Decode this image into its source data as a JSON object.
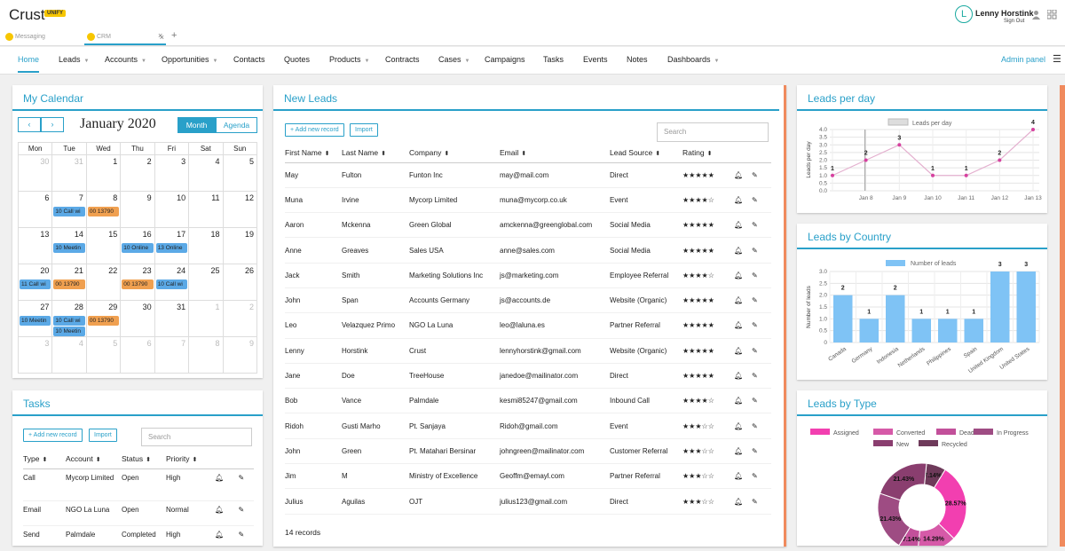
{
  "app": {
    "brand": "Crust",
    "badge": "UNIFY",
    "user_name": "Lenny Horstink",
    "sign_out": "Sign Out",
    "avatar": "L"
  },
  "browser_tabs": [
    {
      "label": "Messaging"
    },
    {
      "label": "CRM"
    }
  ],
  "nav": {
    "items": [
      {
        "label": "Home",
        "caret": false
      },
      {
        "label": "Leads",
        "caret": true
      },
      {
        "label": "Accounts",
        "caret": true
      },
      {
        "label": "Opportunities",
        "caret": true
      },
      {
        "label": "Contacts",
        "caret": false
      },
      {
        "label": "Quotes",
        "caret": false
      },
      {
        "label": "Products",
        "caret": true
      },
      {
        "label": "Contracts",
        "caret": false
      },
      {
        "label": "Cases",
        "caret": true
      },
      {
        "label": "Campaigns",
        "caret": false
      },
      {
        "label": "Tasks",
        "caret": false
      },
      {
        "label": "Events",
        "caret": false
      },
      {
        "label": "Notes",
        "caret": false
      },
      {
        "label": "Dashboards",
        "caret": true
      }
    ],
    "admin": "Admin panel"
  },
  "calendar": {
    "title": "My Calendar",
    "month": "January 2020",
    "view_month": "Month",
    "view_agenda": "Agenda",
    "days": [
      "Mon",
      "Tue",
      "Wed",
      "Thu",
      "Fri",
      "Sat",
      "Sun"
    ],
    "weeks": [
      [
        {
          "d": "30",
          "off": true
        },
        {
          "d": "31",
          "off": true
        },
        {
          "d": "1"
        },
        {
          "d": "2"
        },
        {
          "d": "3"
        },
        {
          "d": "4"
        },
        {
          "d": "5"
        }
      ],
      [
        {
          "d": "6"
        },
        {
          "d": "7",
          "ev": [
            {
              "t": "10 Call wi",
              "c": "b"
            }
          ]
        },
        {
          "d": "8",
          "ev": [
            {
              "t": "00 13790",
              "c": "o"
            }
          ]
        },
        {
          "d": "9"
        },
        {
          "d": "10"
        },
        {
          "d": "11"
        },
        {
          "d": "12"
        }
      ],
      [
        {
          "d": "13"
        },
        {
          "d": "14",
          "ev": [
            {
              "t": "10 Meetin",
              "c": "b"
            }
          ]
        },
        {
          "d": "15"
        },
        {
          "d": "16",
          "ev": [
            {
              "t": "10 Online",
              "c": "b"
            }
          ]
        },
        {
          "d": "17",
          "ev": [
            {
              "t": "13 Online",
              "c": "b"
            }
          ]
        },
        {
          "d": "18"
        },
        {
          "d": "19"
        }
      ],
      [
        {
          "d": "20",
          "ev": [
            {
              "t": "11 Call wi",
              "c": "b"
            }
          ]
        },
        {
          "d": "21",
          "ev": [
            {
              "t": "00 13790",
              "c": "o"
            }
          ]
        },
        {
          "d": "22"
        },
        {
          "d": "23",
          "ev": [
            {
              "t": "00 13790",
              "c": "o"
            }
          ]
        },
        {
          "d": "24",
          "ev": [
            {
              "t": "10 Call wi",
              "c": "b"
            }
          ]
        },
        {
          "d": "25"
        },
        {
          "d": "26"
        }
      ],
      [
        {
          "d": "27",
          "ev": [
            {
              "t": "10 Meetin",
              "c": "b"
            }
          ]
        },
        {
          "d": "28",
          "ev": [
            {
              "t": "10 Call wi",
              "c": "b"
            },
            {
              "t": "10 Meetin",
              "c": "b"
            }
          ]
        },
        {
          "d": "29",
          "ev": [
            {
              "t": "00 13790",
              "c": "o"
            }
          ]
        },
        {
          "d": "30"
        },
        {
          "d": "31"
        },
        {
          "d": "1",
          "off": true
        },
        {
          "d": "2",
          "off": true
        }
      ],
      [
        {
          "d": "3",
          "off": true
        },
        {
          "d": "4",
          "off": true
        },
        {
          "d": "5",
          "off": true
        },
        {
          "d": "6",
          "off": true
        },
        {
          "d": "7",
          "off": true
        },
        {
          "d": "8",
          "off": true
        },
        {
          "d": "9",
          "off": true
        }
      ]
    ]
  },
  "tasks": {
    "title": "Tasks",
    "add": "+ Add new record",
    "import": "Import",
    "search": "Search",
    "columns": [
      "Type",
      "Account",
      "Status",
      "Priority"
    ],
    "rows": [
      {
        "type": "Call",
        "account": "Mycorp Limited",
        "status": "Open",
        "priority": "High"
      },
      {
        "type": "Email",
        "account": "NGO La Luna",
        "status": "Open",
        "priority": "Normal"
      },
      {
        "type": "Send",
        "account": "Palmdale",
        "status": "Completed",
        "priority": "High"
      }
    ]
  },
  "leads": {
    "title": "New Leads",
    "add": "+ Add new record",
    "import": "Import",
    "search": "Search",
    "footer": "14 records",
    "columns": [
      "First Name",
      "Last Name",
      "Company",
      "Email",
      "Lead Source",
      "Rating"
    ],
    "rows": [
      {
        "first": "May",
        "last": "Fulton",
        "company": "Funton Inc",
        "email": "may@mail.com",
        "source": "Direct",
        "rating": "★★★★★"
      },
      {
        "first": "Muna",
        "last": "Irvine",
        "company": "Mycorp Limited",
        "email": "muna@mycorp.co.uk",
        "source": "Event",
        "rating": "★★★★☆"
      },
      {
        "first": "Aaron",
        "last": "Mckenna",
        "company": "Green Global",
        "email": "amckenna@greenglobal.com",
        "source": "Social Media",
        "rating": "★★★★★"
      },
      {
        "first": "Anne",
        "last": "Greaves",
        "company": "Sales USA",
        "email": "anne@sales.com",
        "source": "Social Media",
        "rating": "★★★★★"
      },
      {
        "first": "Jack",
        "last": "Smith",
        "company": "Marketing Solutions Inc",
        "email": "js@marketing.com",
        "source": "Employee Referral",
        "rating": "★★★★☆"
      },
      {
        "first": "John",
        "last": "Span",
        "company": "Accounts Germany",
        "email": "js@accounts.de",
        "source": "Website (Organic)",
        "rating": "★★★★★"
      },
      {
        "first": "Leo",
        "last": "Velazquez Primo",
        "company": "NGO La Luna",
        "email": "leo@laluna.es",
        "source": "Partner Referral",
        "rating": "★★★★★"
      },
      {
        "first": "Lenny",
        "last": "Horstink",
        "company": "Crust",
        "email": "lennyhorstink@gmail.com",
        "source": "Website (Organic)",
        "rating": "★★★★★"
      },
      {
        "first": "Jane",
        "last": "Doe",
        "company": "TreeHouse",
        "email": "janedoe@mailinator.com",
        "source": "Direct",
        "rating": "★★★★★"
      },
      {
        "first": "Bob",
        "last": "Vance",
        "company": "Palmdale",
        "email": "kesmi85247@gmail.com",
        "source": "Inbound Call",
        "rating": "★★★★☆"
      },
      {
        "first": "Ridoh",
        "last": "Gusti Marho",
        "company": "Pt. Sanjaya",
        "email": "Ridoh@gmail.com",
        "source": "Event",
        "rating": "★★★☆☆"
      },
      {
        "first": "John",
        "last": "Green",
        "company": "Pt. Matahari Bersinar",
        "email": "johngreen@mailinator.com",
        "source": "Customer Referral",
        "rating": "★★★☆☆"
      },
      {
        "first": "Jim",
        "last": "M",
        "company": "Ministry of Excellence",
        "email": "Geoffm@emayl.com",
        "source": "Partner Referral",
        "rating": "★★★☆☆"
      },
      {
        "first": "Julius",
        "last": "Aguilas",
        "company": "OJT",
        "email": "julius123@gmail.com",
        "source": "Direct",
        "rating": "★★★☆☆"
      }
    ]
  },
  "chart_data": [
    {
      "type": "line",
      "title": "Leads per day",
      "legend": "Leads per day",
      "ylabel": "Leads per day",
      "x": [
        "Jan 8",
        "Jan 9",
        "Jan 10",
        "Jan 11",
        "Jan 12",
        "Jan 13"
      ],
      "points": [
        {
          "x": "Jan 7",
          "y": 1
        },
        {
          "x": "Jan 8",
          "y": 2
        },
        {
          "x": "Jan 9",
          "y": 3
        },
        {
          "x": "Jan 10",
          "y": 1
        },
        {
          "x": "Jan 11",
          "y": 1
        },
        {
          "x": "Jan 12",
          "y": 2
        },
        {
          "x": "Jan 13",
          "y": 4
        }
      ],
      "yticks": [
        "0.0",
        "0.5",
        "1.0",
        "1.5",
        "2.0",
        "2.5",
        "3.0",
        "3.5",
        "4.0"
      ],
      "ylim": [
        0,
        4
      ],
      "color": "#d6409f"
    },
    {
      "type": "bar",
      "title": "Leads by Country",
      "legend": "Number of leads",
      "ylabel": "Number of leads",
      "categories": [
        "Canada",
        "Germany",
        "Indonesia",
        "Netherlands",
        "Philippines",
        "Spain",
        "United Kingdom",
        "United States"
      ],
      "values": [
        2,
        1,
        2,
        1,
        1,
        1,
        3,
        3
      ],
      "yticks": [
        "0",
        "0.5",
        "1.0",
        "1.5",
        "2.0",
        "2.5",
        "3.0"
      ],
      "ylim": [
        0,
        3
      ],
      "color": "#7fc3f5"
    },
    {
      "type": "pie",
      "title": "Leads by Type",
      "legend": [
        {
          "name": "Assigned",
          "color": "#f23fb0"
        },
        {
          "name": "Converted",
          "color": "#d65aa8"
        },
        {
          "name": "Dead",
          "color": "#c2509a"
        },
        {
          "name": "In Progress",
          "color": "#9e4c83"
        },
        {
          "name": "New",
          "color": "#8a3e6f"
        },
        {
          "name": "Recycled",
          "color": "#6e3a5a"
        }
      ],
      "slices": [
        {
          "name": "Assigned",
          "value": 28.57,
          "label": "28.57%"
        },
        {
          "name": "Converted",
          "value": 14.29,
          "label": "14.29%"
        },
        {
          "name": "Dead",
          "value": 7.14,
          "label": "7.14%"
        },
        {
          "name": "In Progress",
          "value": 21.43,
          "label": "21.43%"
        },
        {
          "name": "New",
          "value": 21.43,
          "label": "21.43%"
        },
        {
          "name": "Recycled",
          "value": 7.14,
          "label": "7.14%"
        }
      ]
    }
  ]
}
